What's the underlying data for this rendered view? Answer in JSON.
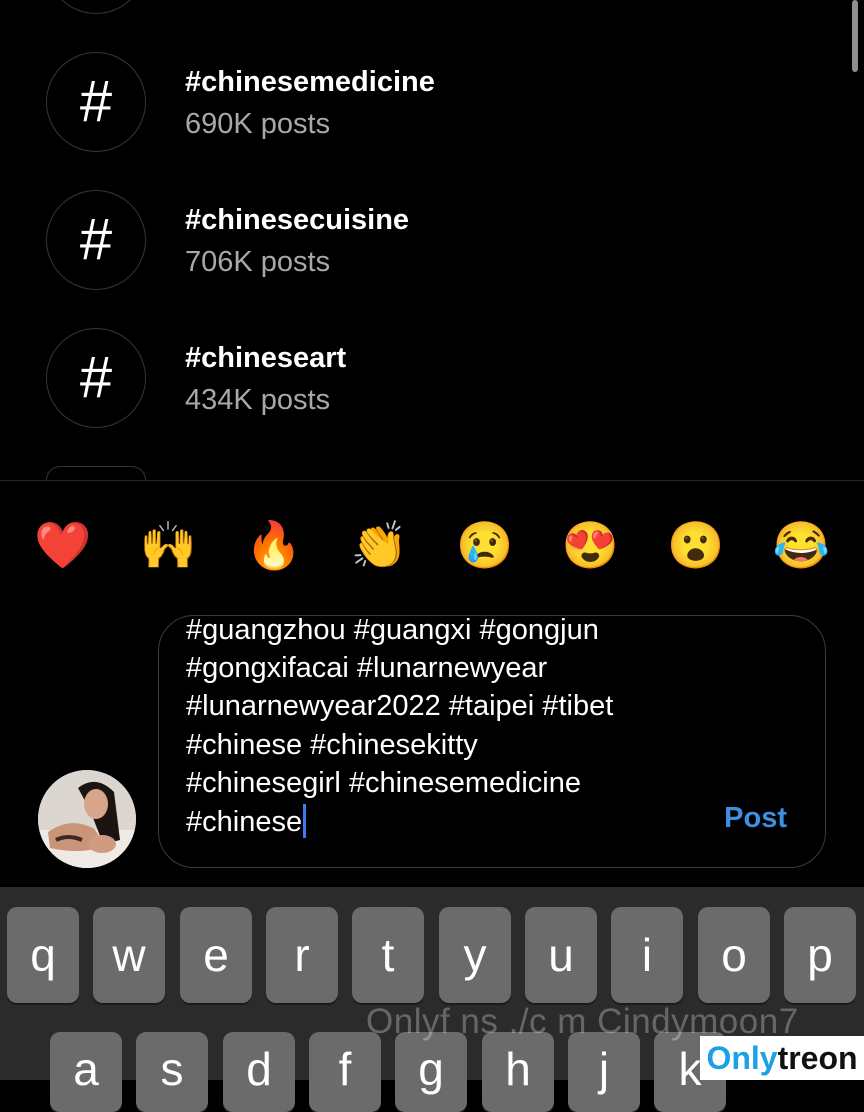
{
  "hashtags": [
    {
      "tag": "#chinesemedicine",
      "posts": "690K posts"
    },
    {
      "tag": "#chinesecuisine",
      "posts": "706K posts"
    },
    {
      "tag": "#chineseart",
      "posts": "434K posts"
    }
  ],
  "hash_symbol": "#",
  "emojis": [
    "❤️",
    "🙌",
    "🔥",
    "👏",
    "😢",
    "😍",
    "😮",
    "😂"
  ],
  "comment": {
    "lines": [
      "#guangzhou #guangxi #gongjun",
      "#gongxifacai #lunarnewyear",
      "#lunarnewyear2022 #taipei #tibet",
      "#chinese #chinesekitty",
      "#chinesegirl #chinesemedicine",
      "#chinese"
    ],
    "post_label": "Post"
  },
  "keyboard": {
    "row1": [
      "q",
      "w",
      "e",
      "r",
      "t",
      "y",
      "u",
      "i",
      "o",
      "p"
    ],
    "row2": [
      "a",
      "s",
      "d",
      "f",
      "g",
      "h",
      "j",
      "k"
    ]
  },
  "watermark": "Onlyf ns ./c m Cindymoon7",
  "logo": {
    "part1": "Only",
    "part2": "treon"
  },
  "colors": {
    "background": "#000000",
    "accent": "#3d8fe0",
    "secondary_text": "#a8a8a8"
  }
}
